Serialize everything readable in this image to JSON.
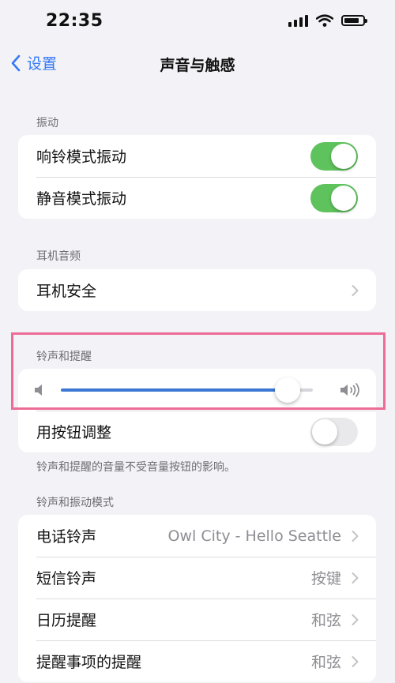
{
  "status_bar": {
    "time": "22:35",
    "battery_level": 0.85
  },
  "nav": {
    "back_label": "设置",
    "title": "声音与触感"
  },
  "sections": {
    "vibration": {
      "header": "振动",
      "rows": [
        {
          "label": "响铃模式振动",
          "toggle": true
        },
        {
          "label": "静音模式振动",
          "toggle": true
        }
      ]
    },
    "headphone_audio": {
      "header": "耳机音频",
      "rows": [
        {
          "label": "耳机安全"
        }
      ]
    },
    "ringer_alerts": {
      "header": "铃声和提醒",
      "volume_level": 0.9,
      "change_with_buttons": {
        "label": "用按钮调整",
        "toggle": false
      },
      "footnote": "铃声和提醒的音量不受音量按钮的影响。"
    },
    "sounds_patterns": {
      "header": "铃声和振动模式",
      "rows": [
        {
          "label": "电话铃声",
          "value": "Owl City - Hello Seattle"
        },
        {
          "label": "短信铃声",
          "value": "按键"
        },
        {
          "label": "日历提醒",
          "value": "和弦"
        },
        {
          "label": "提醒事项的提醒",
          "value": "和弦"
        }
      ]
    }
  },
  "colors": {
    "accent": "#3478f6",
    "toggle_on": "#5fc35d",
    "slider_fill": "#3a78d4",
    "highlight": "#ec6c95"
  },
  "icons": [
    "back-chevron-icon",
    "chevron-right-icon",
    "speaker-low-icon",
    "speaker-high-icon",
    "signal-icon",
    "wifi-icon",
    "battery-icon"
  ]
}
